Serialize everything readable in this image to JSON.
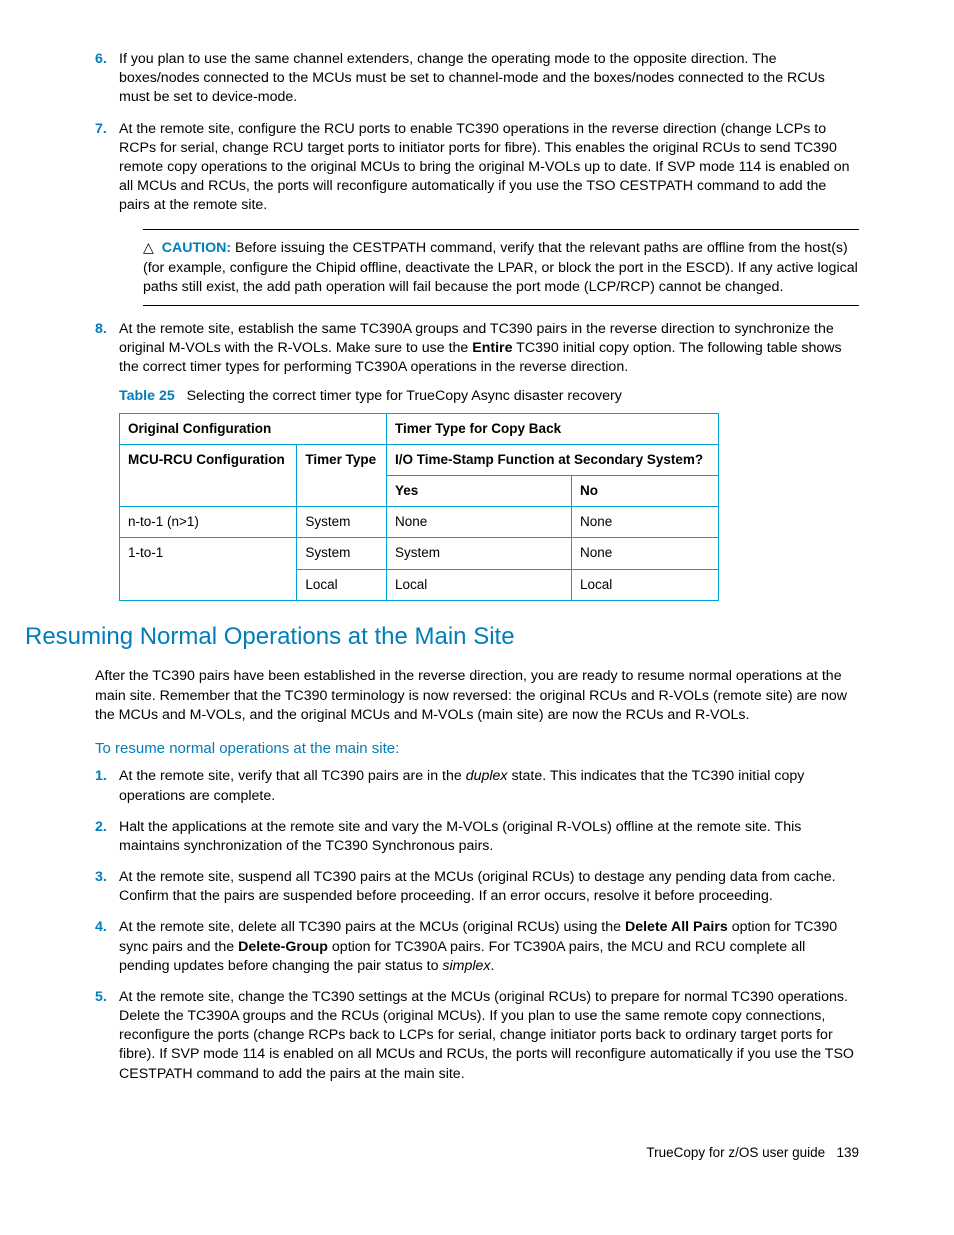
{
  "list1": {
    "items": [
      {
        "num": "6.",
        "text": "If you plan to use the same channel extenders, change the operating mode to the opposite direction. The boxes/nodes connected to the MCUs must be set to channel-mode and the boxes/nodes connected to the RCUs must be set to device-mode."
      },
      {
        "num": "7.",
        "text": "At the remote site, configure the RCU ports to enable TC390 operations in the reverse direction (change LCPs to RCPs for serial, change RCU target ports to initiator ports for fibre). This enables the original RCUs to send TC390 remote copy operations to the original MCUs to bring the original M-VOLs up to date. If SVP mode 114 is enabled on all MCUs and RCUs, the ports will reconfigure automatically if you use the TSO CESTPATH command to add the pairs at the remote site."
      }
    ]
  },
  "caution": {
    "label": "CAUTION:",
    "text": "Before issuing the CESTPATH command, verify that the relevant paths are offline from the host(s) (for example, configure the Chipid offline, deactivate the LPAR, or block the port in the ESCD). If any active logical paths still exist, the add path operation will fail because the port mode (LCP/RCP) cannot be changed."
  },
  "item8": {
    "num": "8.",
    "pre": "At the remote site, establish the same TC390A groups and TC390 pairs in the reverse direction to synchronize the original M-VOLs with the R-VOLs. Make sure to use the ",
    "bold": "Entire",
    "post": " TC390 initial copy option. The following table shows the correct timer types for performing TC390A operations in the reverse direction."
  },
  "table": {
    "caption_num": "Table 25",
    "caption_text": "Selecting the correct timer type for TrueCopy Async disaster recovery",
    "h_orig": "Original Configuration",
    "h_timer": "Timer Type for Copy Back",
    "h_mcu": "MCU-RCU Configuration",
    "h_tt": "Timer Type",
    "h_io": "I/O Time-Stamp Function at Secondary System?",
    "h_yes": "Yes",
    "h_no": "No",
    "rows": [
      {
        "c0": "n-to-1 (n>1)",
        "c1": "System",
        "c2": "None",
        "c3": "None"
      },
      {
        "c0": "1-to-1",
        "c1": "System",
        "c2": "System",
        "c3": "None"
      },
      {
        "c0": "",
        "c1": "Local",
        "c2": "Local",
        "c3": "Local"
      }
    ]
  },
  "section": {
    "title": "Resuming Normal Operations at the Main Site",
    "intro": "After the TC390 pairs have been established in the reverse direction, you are ready to resume normal operations at the main site. Remember that the TC390 terminology is now reversed: the original RCUs and R-VOLs (remote site) are now the MCUs and M-VOLs, and the original MCUs and M-VOLs (main site) are now the RCUs and R-VOLs.",
    "subhead": "To resume normal operations at the main site:"
  },
  "list2": {
    "i1": {
      "num": "1.",
      "pre": "At the remote site, verify that all TC390 pairs are in the ",
      "it": "duplex",
      "post": " state. This indicates that the TC390 initial copy operations are complete."
    },
    "i2": {
      "num": "2.",
      "text": "Halt the applications at the remote site and vary the M-VOLs (original R-VOLs) offline at the remote site. This maintains synchronization of the TC390 Synchronous pairs."
    },
    "i3": {
      "num": "3.",
      "text": "At the remote site, suspend all TC390 pairs at the MCUs (original RCUs) to destage any pending data from cache. Confirm that the pairs are suspended before proceeding. If an error occurs, resolve it before proceeding."
    },
    "i4": {
      "num": "4.",
      "a": "At the remote site, delete all TC390 pairs at the MCUs (original RCUs) using the ",
      "b1": "Delete All Pairs",
      "b": " option for TC390 sync pairs and the ",
      "b2": "Delete-Group",
      "c": " option for TC390A pairs. For TC390A pairs, the MCU and RCU complete all pending updates before changing the pair status to ",
      "it": "simplex",
      "d": "."
    },
    "i5": {
      "num": "5.",
      "text": "At the remote site, change the TC390 settings at the MCUs (original RCUs) to prepare for normal TC390 operations. Delete the TC390A groups and the RCUs (original MCUs). If you plan to use the same remote copy connections, reconfigure the ports (change RCPs back to LCPs for serial, change initiator ports back to ordinary target ports for fibre). If SVP mode 114 is enabled on all MCUs and RCUs, the ports will reconfigure automatically if you use the TSO CESTPATH command to add the pairs at the main site."
    }
  },
  "footer": {
    "text": "TrueCopy for z/OS user guide",
    "page": "139"
  }
}
